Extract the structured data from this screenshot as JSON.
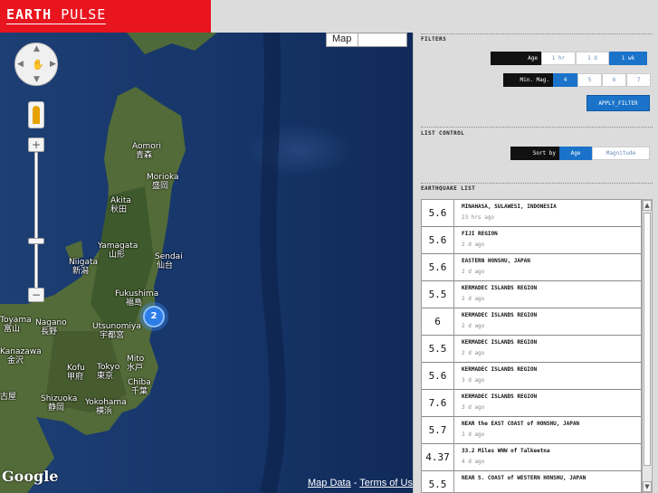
{
  "header": {
    "logo_earth": "EARTH",
    "logo_pulse": "PULSE"
  },
  "map": {
    "map_type": "Map",
    "cities": [
      {
        "en": "Aomori",
        "ja": "青森"
      },
      {
        "en": "Morioka",
        "ja": "盛岡"
      },
      {
        "en": "Akita",
        "ja": "秋田"
      },
      {
        "en": "Yamagata",
        "ja": "山形"
      },
      {
        "en": "Sendai",
        "ja": "仙台"
      },
      {
        "en": "Niigata",
        "ja": "新潟"
      },
      {
        "en": "Fukushima",
        "ja": "福島"
      },
      {
        "en": "Toyama",
        "ja": "富山"
      },
      {
        "en": "Nagano",
        "ja": "長野"
      },
      {
        "en": "Utsunomiya",
        "ja": "宇都宮"
      },
      {
        "en": "Kanazawa",
        "ja": "金沢"
      },
      {
        "en": "Mito",
        "ja": "水戸"
      },
      {
        "en": "Kofu",
        "ja": "甲府"
      },
      {
        "en": "Tokyo",
        "ja": "東京"
      },
      {
        "en": "Chiba",
        "ja": "千葉"
      },
      {
        "en": "Shizuoka",
        "ja": "静岡"
      },
      {
        "en": "Yokohama",
        "ja": "横浜"
      },
      {
        "en": "",
        "ja": "古屋"
      }
    ],
    "cluster_count": "2",
    "google_logo": "Google",
    "map_data_link": "Map Data",
    "separator": " - ",
    "terms_link": "Terms of Use"
  },
  "filters": {
    "title": "FILTERS",
    "age_label": "Age",
    "age_options": [
      "1 hr",
      "1 d",
      "1 wk"
    ],
    "age_active": "1 wk",
    "mag_label": "Min. Mag.",
    "mag_options": [
      "4",
      "5",
      "6",
      "7"
    ],
    "mag_active": "4",
    "apply_label": "APPLY_FILTER"
  },
  "list_control": {
    "title": "LIST CONTROL",
    "sort_label": "Sort by",
    "sort_options": [
      "Age",
      "Magnitude"
    ],
    "sort_active": "Age"
  },
  "earthquake_list": {
    "title": "EARTHQUAKE LIST",
    "items": [
      {
        "mag": "5.6",
        "place": "MINAHASA, SULAWESI, INDONESIA",
        "age": "23 hrs ago"
      },
      {
        "mag": "5.6",
        "place": "FIJI REGION",
        "age": "2 d ago"
      },
      {
        "mag": "5.6",
        "place": "EASTERN HONSHU, JAPAN",
        "age": "2 d ago"
      },
      {
        "mag": "5.5",
        "place": "KERMADEC ISLANDS REGION",
        "age": "2 d ago"
      },
      {
        "mag": "6",
        "place": "KERMADEC ISLANDS REGION",
        "age": "2 d ago"
      },
      {
        "mag": "5.5",
        "place": "KERMADEC ISLANDS REGION",
        "age": "2 d ago"
      },
      {
        "mag": "5.6",
        "place": "KERMADEC ISLANDS REGION",
        "age": "3 d ago"
      },
      {
        "mag": "7.6",
        "place": "KERMADEC ISLANDS REGION",
        "age": "3 d ago"
      },
      {
        "mag": "5.7",
        "place": "NEAR the EAST COAST of HONSHU, JAPAN",
        "age": "3 d ago"
      },
      {
        "mag": "4.37",
        "place": "33.2 Miles WNW of Talkeetna",
        "age": "4 d ago"
      },
      {
        "mag": "5.5",
        "place": "NEAR S. COAST of WESTERN HONSHU, JAPAN",
        "age": ""
      }
    ]
  },
  "colors": {
    "brand": "#e8141e",
    "accent": "#1a73c9",
    "panel": "#dcdcdc"
  },
  "icons": [
    "pan-control-icon",
    "pegman-icon",
    "zoom-in-icon",
    "zoom-out-icon",
    "scroll-up-icon",
    "scroll-down-icon"
  ]
}
